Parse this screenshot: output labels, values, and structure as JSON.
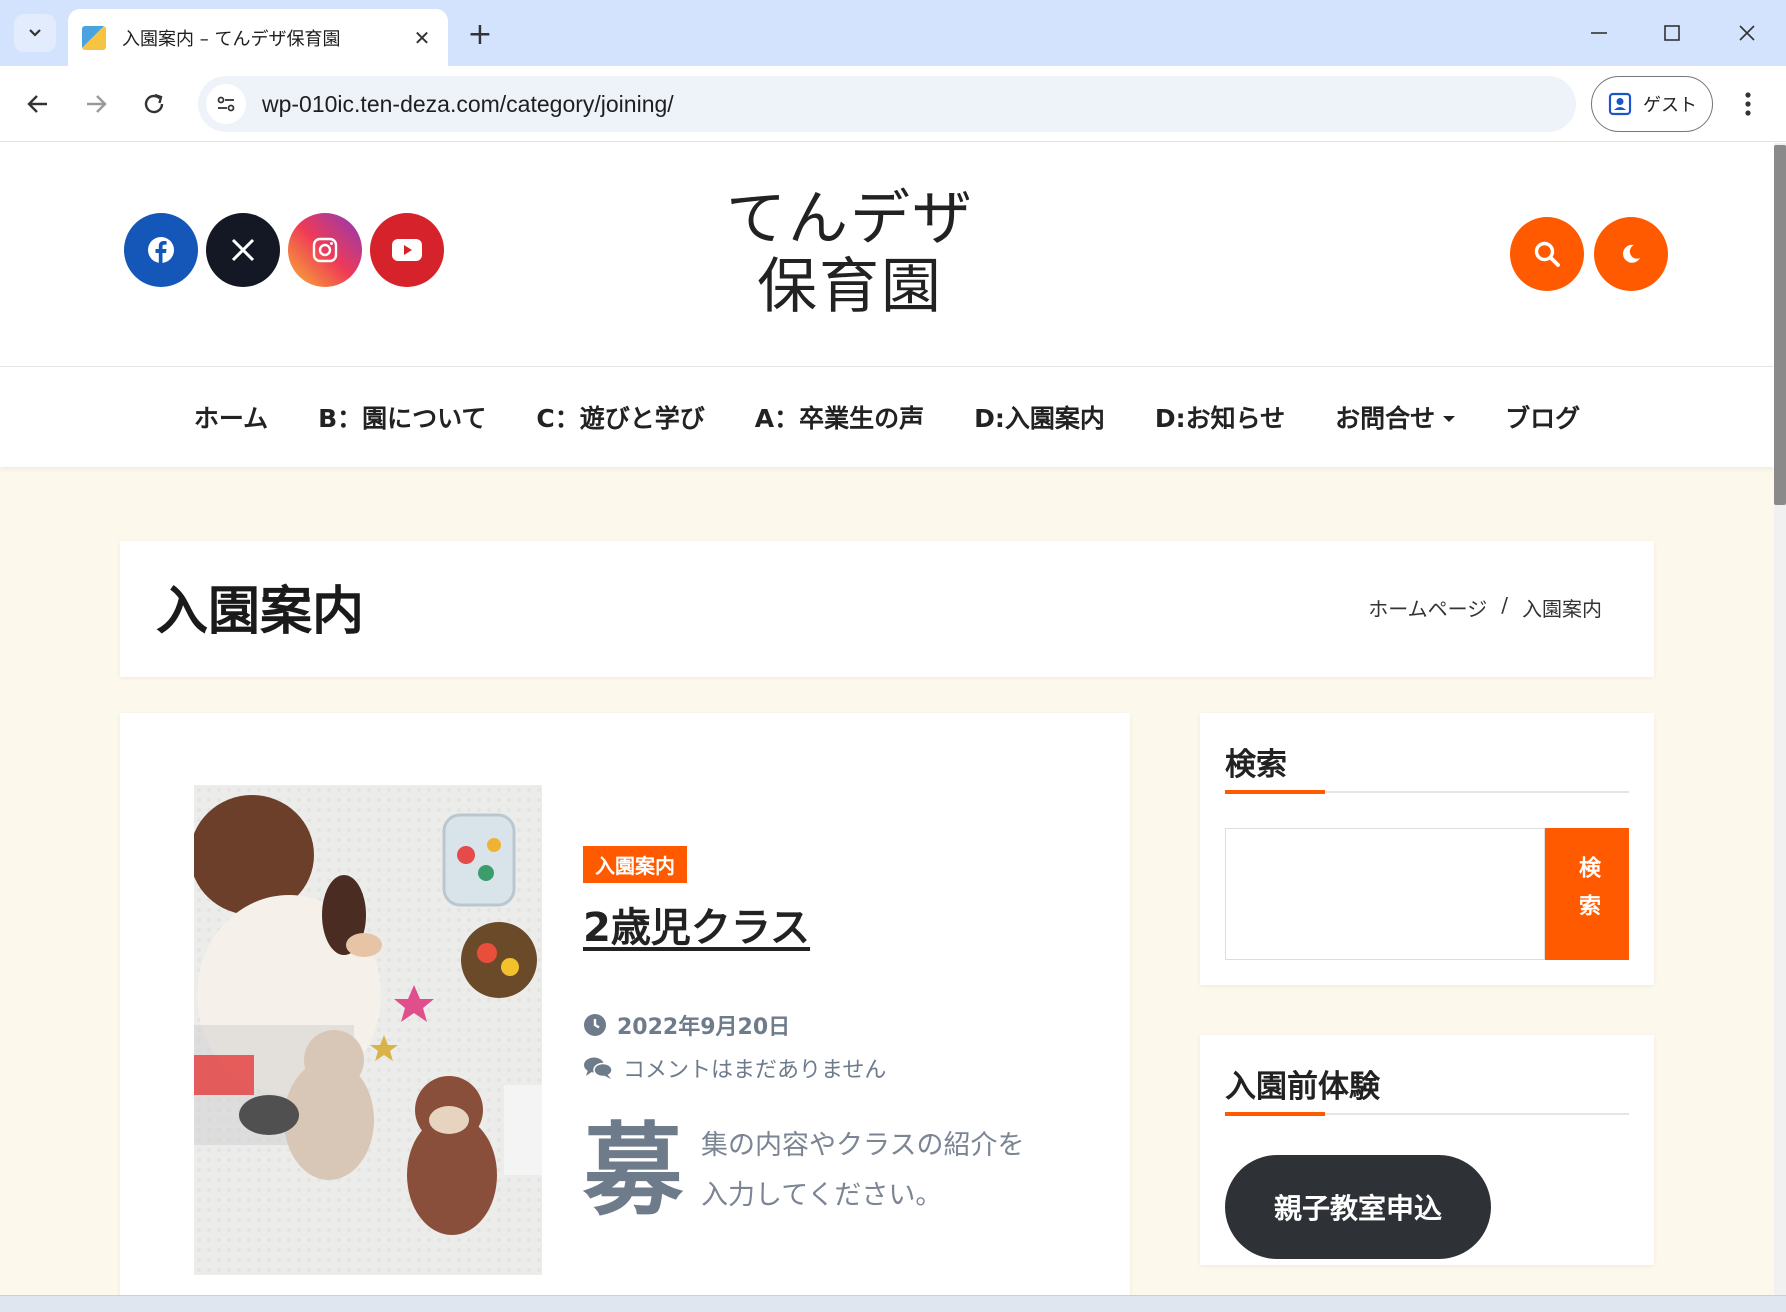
{
  "browser": {
    "tab_title": "入園案内 – てんデザ保育園",
    "url": "wp-010ic.ten-deza.com/category/joining/",
    "profile_label": "ゲスト"
  },
  "site": {
    "logo_line1": "てんデザ",
    "logo_line2": "保育園",
    "social": [
      "facebook",
      "x",
      "instagram",
      "youtube"
    ],
    "nav": [
      {
        "label": "ホーム"
      },
      {
        "label": "B：園について"
      },
      {
        "label": "C：遊びと学び"
      },
      {
        "label": "A：卒業生の声"
      },
      {
        "label": "D:入園案内"
      },
      {
        "label": "D:お知らせ"
      },
      {
        "label": "お問合せ",
        "has_dropdown": true
      },
      {
        "label": "ブログ"
      }
    ],
    "accent_color": "#ff5a00"
  },
  "page": {
    "title": "入園案内",
    "breadcrumb": [
      "ホームページ",
      "/",
      "入園案内"
    ]
  },
  "post": {
    "category": "入園案内",
    "title": "2歳児クラス",
    "date": "2022年9月20日",
    "comments": "コメントはまだありません",
    "dropcap": "募",
    "excerpt_line1": "集の内容やクラスの紹介を",
    "excerpt_line2": "入力してください。"
  },
  "sidebar": {
    "search_title": "検索",
    "search_button": "検索",
    "trial_title": "入園前体験",
    "trial_button": "親子教室申込"
  }
}
